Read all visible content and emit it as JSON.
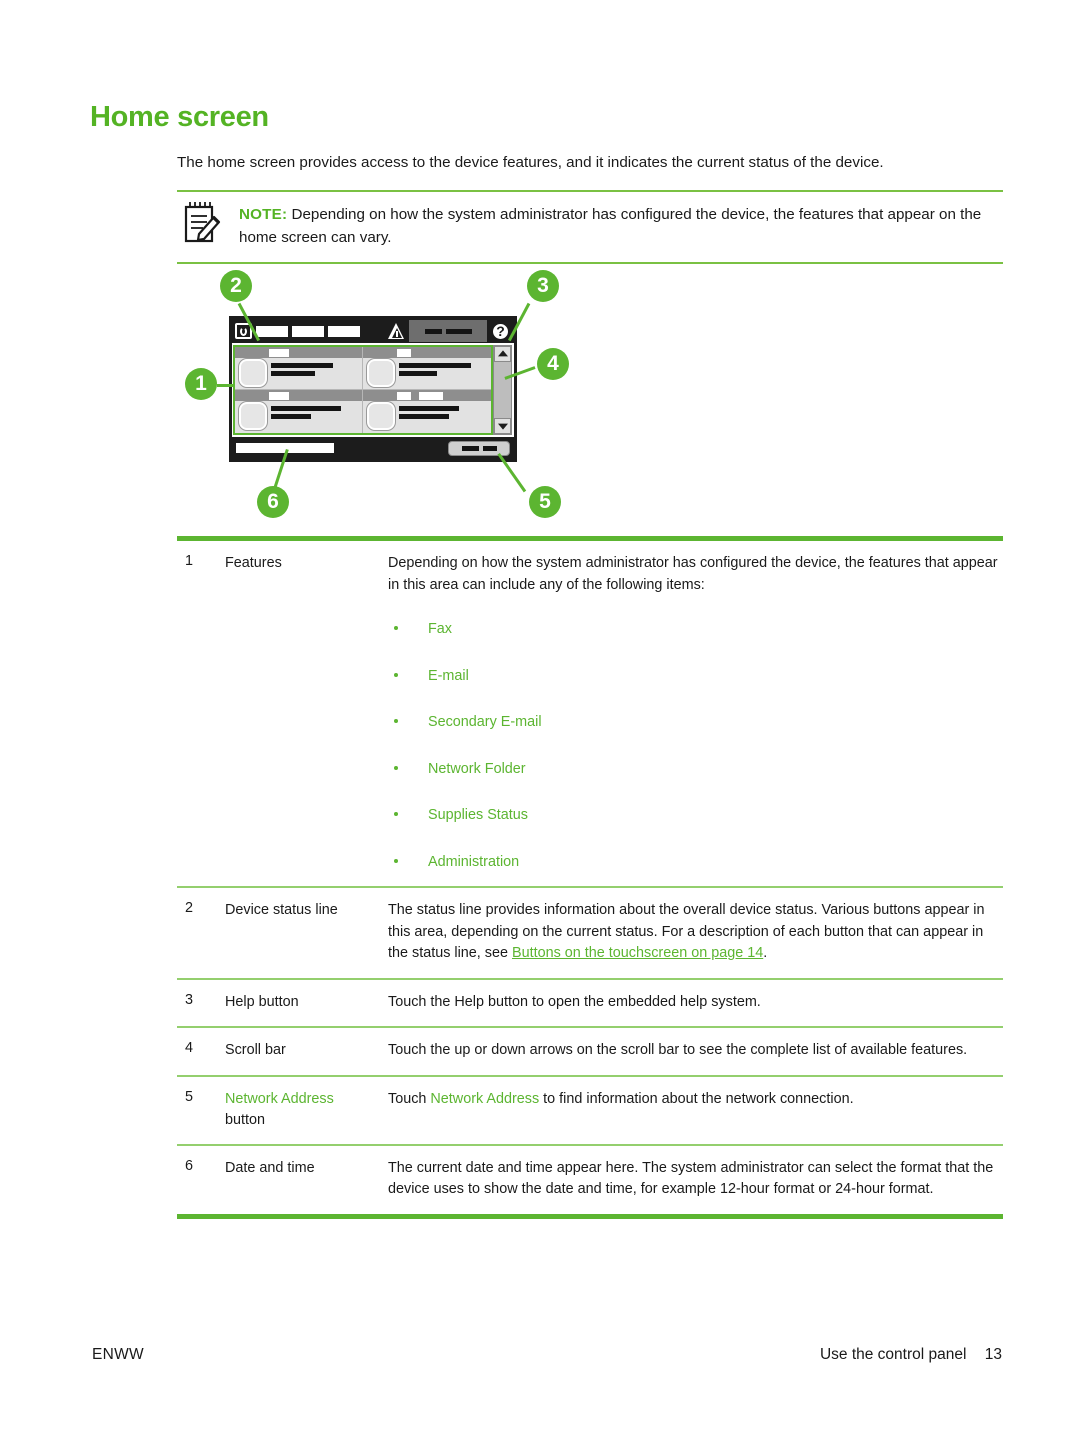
{
  "document": {
    "title": "Home screen",
    "intro": "The home screen provides access to the device features, and it indicates the current status of the device."
  },
  "note": {
    "icon": "note-pencil-icon",
    "label": "NOTE:",
    "text": "Depending on how the system administrator has configured the device, the features that appear on the home screen can vary."
  },
  "diagram": {
    "name": "control-panel-home-screen-diagram",
    "callouts": [
      {
        "number": "1",
        "target": "features-area"
      },
      {
        "number": "2",
        "target": "device-status-line"
      },
      {
        "number": "3",
        "target": "help-button"
      },
      {
        "number": "4",
        "target": "scroll-bar"
      },
      {
        "number": "5",
        "target": "network-address-button"
      },
      {
        "number": "6",
        "target": "date-and-time"
      }
    ],
    "icons": {
      "hp_logo": "hp-logo-icon",
      "warning": "warning-triangle-icon",
      "help": "help-question-icon",
      "scroll_up": "chevron-up-icon",
      "scroll_down": "chevron-down-icon"
    }
  },
  "table": {
    "rows": [
      {
        "num": "1",
        "name": "Features",
        "desc": "Depending on how the system administrator has configured the device, the features that appear in this area can include any of the following items:",
        "bullets": [
          "Fax",
          "E-mail",
          "Secondary E-mail",
          "Network Folder",
          "Supplies Status",
          "Administration"
        ]
      },
      {
        "num": "2",
        "name": "Device status line",
        "desc_pre": "The status line provides information about the overall device status. Various buttons appear in this area, depending on the current status. For a description of each button that can appear in the status line, see ",
        "link": "Buttons on the touchscreen on page 14",
        "desc_post": "."
      },
      {
        "num": "3",
        "name": "Help button",
        "desc": "Touch the Help button to open the embedded help system."
      },
      {
        "num": "4",
        "name": "Scroll bar",
        "desc": "Touch the up or down arrows on the scroll bar to see the complete list of available features."
      },
      {
        "num": "5",
        "name_term": "Network Address",
        "name_rest": "button",
        "desc_pre": "Touch ",
        "desc_term": "Network Address",
        "desc_post": " to find information about the network connection."
      },
      {
        "num": "6",
        "name": "Date and time",
        "desc": "The current date and time appear here. The system administrator can select the format that the device uses to show the date and time, for example 12-hour format or 24-hour format."
      }
    ]
  },
  "footer": {
    "left": "ENWW",
    "right": "Use the control panel",
    "page": "13"
  },
  "colors": {
    "accent_green": "#5cb531",
    "title_green": "#54b324",
    "rule_light": "#94cf6e",
    "text": "#1a1a1a"
  }
}
